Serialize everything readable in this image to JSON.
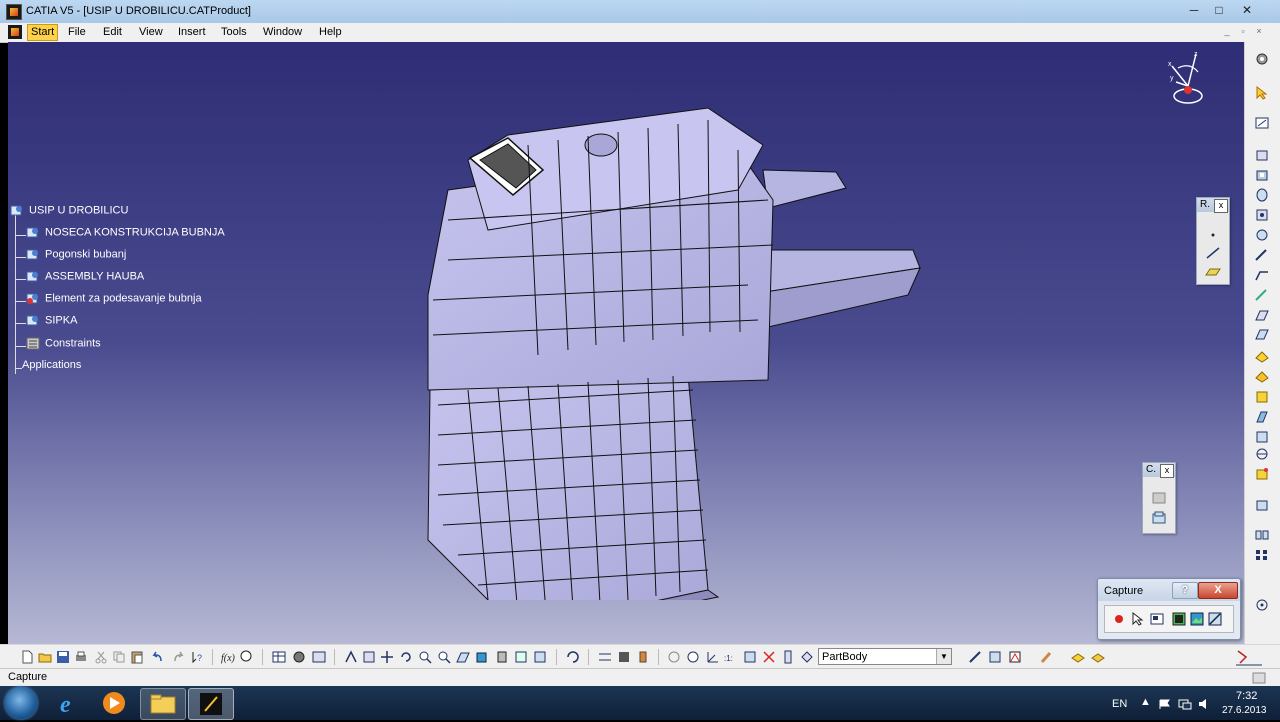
{
  "window": {
    "title": "CATIA V5 - [USIP U DROBILICU.CATProduct]",
    "minimize": "─",
    "maximize": "□",
    "close": "✕"
  },
  "menubar": {
    "items": [
      {
        "label": "Start",
        "mnemonic": "S"
      },
      {
        "label": "File",
        "mnemonic": "F"
      },
      {
        "label": "Edit",
        "mnemonic": "E"
      },
      {
        "label": "View",
        "mnemonic": "V"
      },
      {
        "label": "Insert",
        "mnemonic": "I"
      },
      {
        "label": "Tools",
        "mnemonic": "T"
      },
      {
        "label": "Window",
        "mnemonic": "W"
      },
      {
        "label": "Help",
        "mnemonic": "H"
      }
    ]
  },
  "tree": {
    "root": "USIP U DROBILICU",
    "children": [
      {
        "label": "NOSECA KONSTRUKCIJA BUBNJA",
        "icon": "product-icon"
      },
      {
        "label": "Pogonski bubanj",
        "icon": "product-icon"
      },
      {
        "label": "ASSEMBLY HAUBA",
        "icon": "product-icon"
      },
      {
        "label": "Element za podesavanje bubnja",
        "icon": "product-warning-icon"
      },
      {
        "label": "SIPKA",
        "icon": "product-icon"
      },
      {
        "label": "Constraints",
        "icon": "constraints-icon"
      }
    ],
    "applications": "Applications"
  },
  "floating_toolbars": {
    "r_toolbar": {
      "title": "R.",
      "close": "x"
    },
    "c_toolbar": {
      "title": "C.",
      "close": "x"
    }
  },
  "capture_dialog": {
    "title": "Capture",
    "help": "?",
    "close": "X"
  },
  "toolbar": {
    "current_body": "PartBody"
  },
  "statusbar": {
    "text": "Capture"
  },
  "tray": {
    "language": "EN",
    "time": "7:32",
    "date": "27.6.2013"
  },
  "colors": {
    "viewport_top": "#2e2d75",
    "viewport_bottom": "#b6b8d4",
    "model_fill": "#b7b5e3"
  }
}
